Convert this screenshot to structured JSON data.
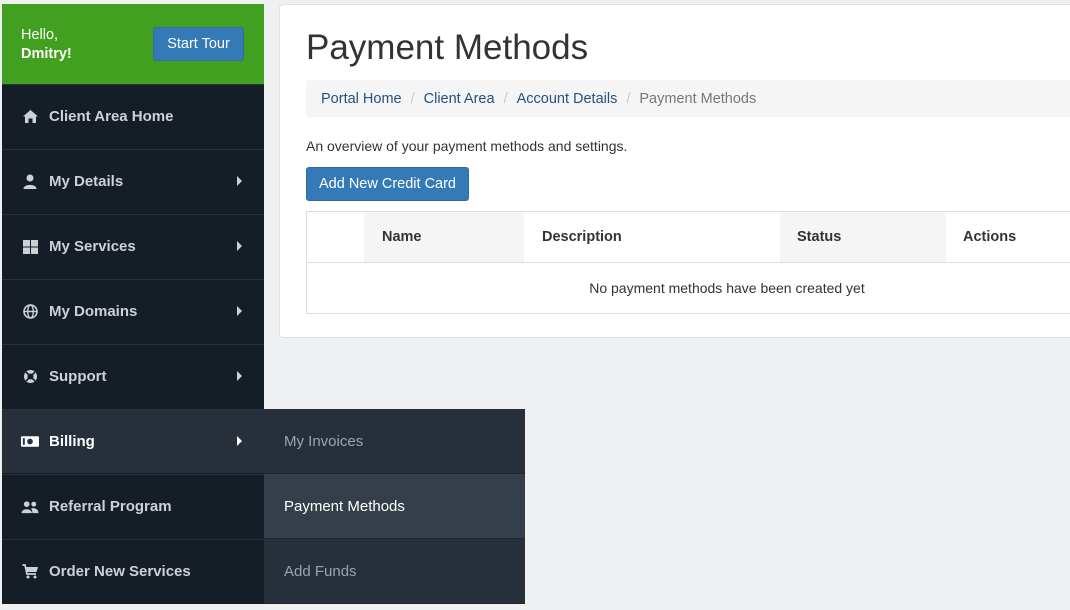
{
  "sidebar": {
    "greeting": "Hello,",
    "user_name": "Dmitry!",
    "tour_button": "Start Tour",
    "items": [
      {
        "label": "Client Area Home",
        "icon": "home-icon"
      },
      {
        "label": "My Details",
        "icon": "user-icon"
      },
      {
        "label": "My Services",
        "icon": "grid-icon"
      },
      {
        "label": "My Domains",
        "icon": "globe-icon"
      },
      {
        "label": "Support",
        "icon": "lifebuoy-icon"
      },
      {
        "label": "Billing",
        "icon": "money-icon"
      },
      {
        "label": "Referral Program",
        "icon": "users-icon"
      },
      {
        "label": "Order New Services",
        "icon": "cart-icon"
      }
    ]
  },
  "submenu": {
    "items": [
      {
        "label": "My Invoices"
      },
      {
        "label": "Payment Methods"
      },
      {
        "label": "Add Funds"
      }
    ]
  },
  "main": {
    "title": "Payment Methods",
    "breadcrumb": [
      "Portal Home",
      "Client Area",
      "Account Details",
      "Payment Methods"
    ],
    "overview": "An overview of your payment methods and settings.",
    "add_button": "Add New Credit Card",
    "table": {
      "columns": [
        "Name",
        "Description",
        "Status",
        "Actions"
      ],
      "empty_message": "No payment methods have been created yet"
    }
  },
  "colors": {
    "accent_green": "#41a01f",
    "primary_blue": "#337ab7",
    "sidebar_bg": "#151e27"
  }
}
